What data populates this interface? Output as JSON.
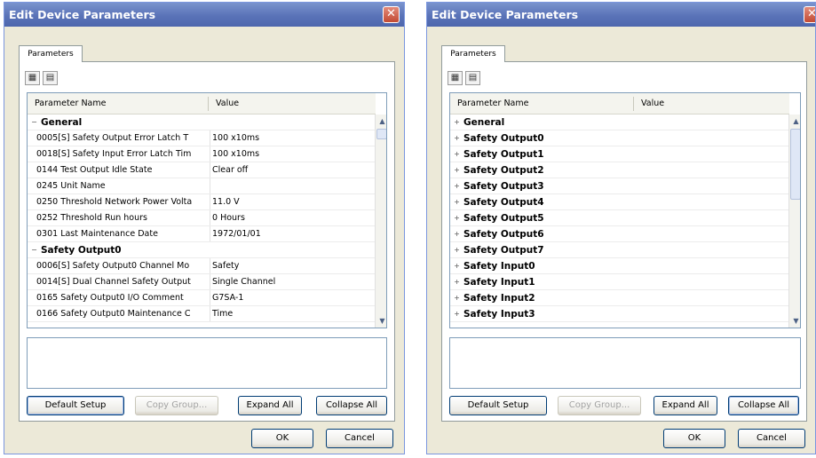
{
  "dialogs": [
    {
      "title": "Edit Device Parameters",
      "tab_label": "Parameters",
      "columns": {
        "name": "Parameter Name",
        "value": "Value"
      },
      "rows": [
        {
          "kind": "category",
          "expander": "−",
          "name": "General",
          "value": ""
        },
        {
          "kind": "param",
          "name": "0005[S] Safety Output Error Latch T",
          "value": "100 x10ms"
        },
        {
          "kind": "param",
          "name": "0018[S] Safety Input Error Latch Tim",
          "value": "100 x10ms"
        },
        {
          "kind": "param",
          "name": "0144 Test Output Idle State",
          "value": "Clear off"
        },
        {
          "kind": "param",
          "name": "0245 Unit Name",
          "value": ""
        },
        {
          "kind": "param",
          "name": "0250 Threshold Network Power Volta",
          "value": "11.0 V"
        },
        {
          "kind": "param",
          "name": "0252 Threshold Run hours",
          "value": "0 Hours"
        },
        {
          "kind": "param",
          "name": "0301 Last Maintenance Date",
          "value": "1972/01/01"
        },
        {
          "kind": "category",
          "expander": "−",
          "name": "Safety Output0",
          "value": ""
        },
        {
          "kind": "param",
          "name": "0006[S] Safety Output0 Channel Mo",
          "value": "Safety"
        },
        {
          "kind": "param",
          "name": "0014[S] Dual Channel Safety Output",
          "value": "Single Channel"
        },
        {
          "kind": "param",
          "name": "0165 Safety Output0 I/O Comment",
          "value": "G7SA-1"
        },
        {
          "kind": "param",
          "name": "0166 Safety Output0 Maintenance C",
          "value": "Time"
        }
      ],
      "buttons": {
        "default_setup": "Default Setup",
        "copy_group": "Copy Group...",
        "expand_all": "Expand All",
        "collapse_all": "Collapse All",
        "ok": "OK",
        "cancel": "Cancel"
      }
    },
    {
      "title": "Edit Device Parameters",
      "tab_label": "Parameters",
      "columns": {
        "name": "Parameter Name",
        "value": "Value"
      },
      "rows": [
        {
          "kind": "category",
          "expander": "+",
          "name": "General",
          "value": ""
        },
        {
          "kind": "category",
          "expander": "+",
          "name": "Safety Output0",
          "value": ""
        },
        {
          "kind": "category",
          "expander": "+",
          "name": "Safety Output1",
          "value": ""
        },
        {
          "kind": "category",
          "expander": "+",
          "name": "Safety Output2",
          "value": ""
        },
        {
          "kind": "category",
          "expander": "+",
          "name": "Safety Output3",
          "value": ""
        },
        {
          "kind": "category",
          "expander": "+",
          "name": "Safety Output4",
          "value": ""
        },
        {
          "kind": "category",
          "expander": "+",
          "name": "Safety Output5",
          "value": ""
        },
        {
          "kind": "category",
          "expander": "+",
          "name": "Safety Output6",
          "value": ""
        },
        {
          "kind": "category",
          "expander": "+",
          "name": "Safety Output7",
          "value": ""
        },
        {
          "kind": "category",
          "expander": "+",
          "name": "Safety Input0",
          "value": ""
        },
        {
          "kind": "category",
          "expander": "+",
          "name": "Safety Input1",
          "value": ""
        },
        {
          "kind": "category",
          "expander": "+",
          "name": "Safety Input2",
          "value": ""
        },
        {
          "kind": "category",
          "expander": "+",
          "name": "Safety Input3",
          "value": ""
        }
      ],
      "buttons": {
        "default_setup": "Default Setup",
        "copy_group": "Copy Group...",
        "expand_all": "Expand All",
        "collapse_all": "Collapse All",
        "ok": "OK",
        "cancel": "Cancel"
      }
    }
  ],
  "icons": {
    "close": "close-icon",
    "list_view": "list-view-icon",
    "property_view": "property-view-icon",
    "expand": "plus-icon",
    "collapse": "minus-icon",
    "scroll_up": "chevron-up-icon",
    "scroll_down": "chevron-down-icon"
  },
  "colors": {
    "titlebar": "#5a73b8",
    "dialog_face": "#ece9d8",
    "close_button": "#c24a33"
  }
}
